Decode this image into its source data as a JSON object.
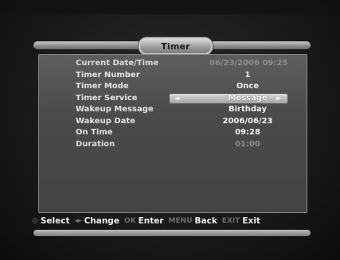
{
  "window": {
    "title": "Timer"
  },
  "fields": [
    {
      "label": "Current Date/Time",
      "value": "06/23/2006   09:25",
      "style": "dim"
    },
    {
      "label": "Timer Number",
      "value": "1",
      "style": "normal"
    },
    {
      "label": "Timer Mode",
      "value": "Once",
      "style": "normal"
    },
    {
      "label": "Timer Service",
      "value": "Message",
      "style": "selected"
    },
    {
      "label": "Wakeup Message",
      "value": "Birthday",
      "style": "normal"
    },
    {
      "label": "Wakeup Date",
      "value": "2006/06/23",
      "style": "normal"
    },
    {
      "label": "On Time",
      "value": "09:28",
      "style": "normal"
    },
    {
      "label": "Duration",
      "value": "01:00",
      "style": "dim"
    }
  ],
  "selector_arrows": {
    "left": "◄",
    "right": "►"
  },
  "help_bar": [
    {
      "key": "◎",
      "label": "Select"
    },
    {
      "key": "◂▸",
      "label": "Change"
    },
    {
      "key": "OK",
      "label": "Enter"
    },
    {
      "key": "MENU",
      "label": "Back"
    },
    {
      "key": "EXIT",
      "label": "Exit"
    }
  ],
  "colors": {
    "panel": "#4a4a4a",
    "frame": "#9d9d9d",
    "text": "#e4e4e4",
    "dim_text": "#8d8d8d"
  }
}
